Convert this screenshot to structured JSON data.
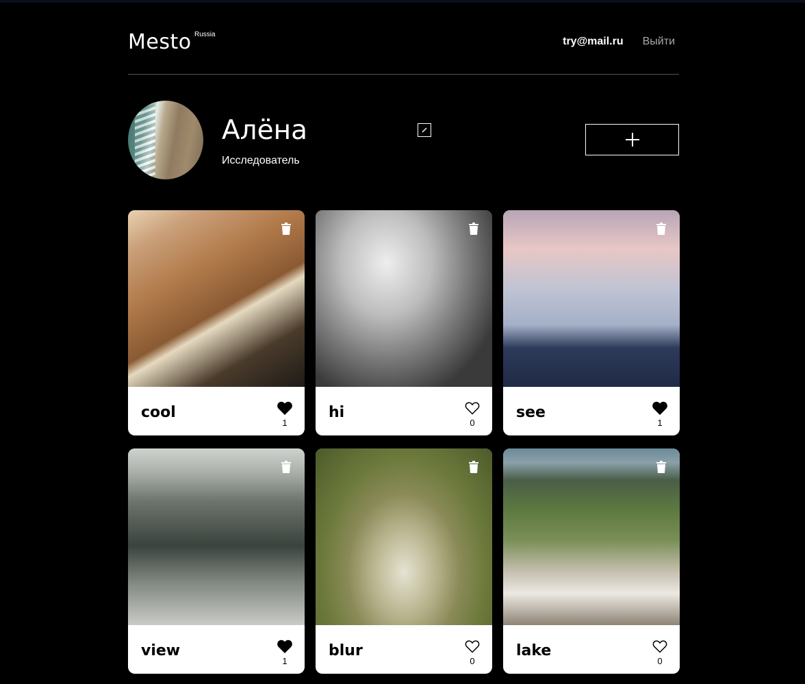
{
  "header": {
    "logo": "Mesto",
    "logo_sup": "Russia",
    "email": "try@mail.ru",
    "logout": "Выйти"
  },
  "profile": {
    "name": "Алёна",
    "about": "Исследователь"
  },
  "cards": [
    {
      "title": "cool",
      "likes": "1",
      "liked": true
    },
    {
      "title": "hi",
      "likes": "0",
      "liked": false
    },
    {
      "title": "see",
      "likes": "1",
      "liked": true
    },
    {
      "title": "view",
      "likes": "1",
      "liked": true
    },
    {
      "title": "blur",
      "likes": "0",
      "liked": false
    },
    {
      "title": "lake",
      "likes": "0",
      "liked": false
    }
  ],
  "icons": {
    "edit": "pencil-icon",
    "add": "plus-icon",
    "delete": "trash-icon",
    "like": "heart-icon"
  }
}
